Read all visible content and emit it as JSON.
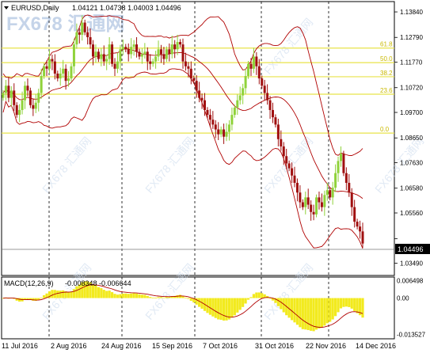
{
  "symbol_header": {
    "symbol": "EURUSD,Daily",
    "ohlc": "1.04121 1.04738 1.04003 1.04496"
  },
  "macd_header": {
    "label": "MACD(12,26,9)",
    "values": "-0.008348 -0.006644"
  },
  "watermark": {
    "brand": "FX678",
    "name": "汇通网"
  },
  "chart_data": {
    "type": "candlestick",
    "price_axis": [
      "1.13840",
      "1.12790",
      "1.11770",
      "1.10720",
      "1.09700",
      "1.08650",
      "1.07630",
      "1.06580",
      "1.05560",
      "1.04496",
      "1.03490"
    ],
    "price_range": [
      1.0305,
      1.142
    ],
    "current_price": "1.04496",
    "macd_axis": [
      "0.006498",
      "0.00",
      "-0.013527"
    ],
    "macd_range": [
      -0.0145,
      0.0072
    ],
    "x_labels": [
      "11 Jul 2016",
      "2 Aug 2016",
      "24 Aug 2016",
      "15 Sep 2016",
      "7 Oct 2016",
      "31 Oct 2016",
      "22 Nov 2016",
      "14 Dec 2016"
    ],
    "fib_levels": [
      {
        "label": "61.8",
        "price": 1.1235
      },
      {
        "label": "50.0",
        "price": 1.1175
      },
      {
        "label": "38.2",
        "price": 1.1117
      },
      {
        "label": "23.6",
        "price": 1.1045
      },
      {
        "label": "0.0",
        "price": 1.0885
      }
    ],
    "candle_colors": {
      "up": "#8fd23a",
      "down": "#a01010"
    },
    "macd_color": "#f2ea1e",
    "band_color": "#b00000",
    "fib_color": "#e8e34a"
  }
}
